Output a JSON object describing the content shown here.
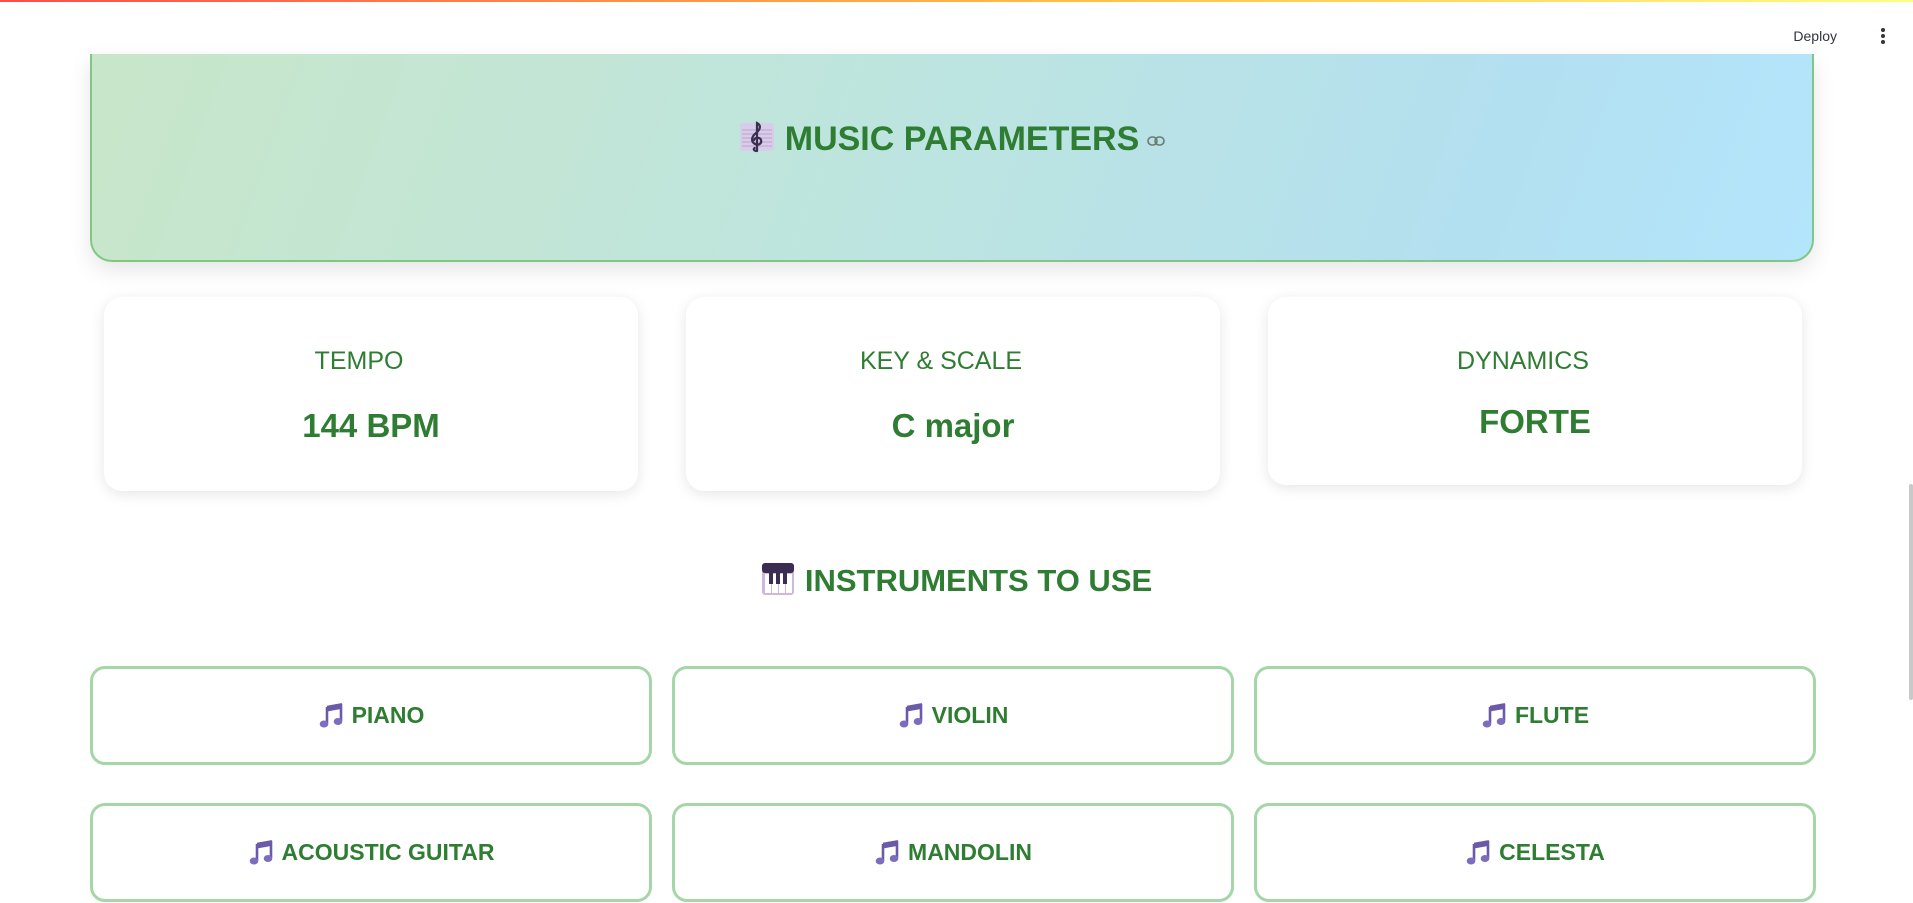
{
  "header": {
    "deploy_label": "Deploy",
    "menu_icon": "kebab-menu-icon"
  },
  "hero": {
    "emoji": "musical-score-icon",
    "title": "MUSIC PARAMETERS",
    "link_icon": "link-icon"
  },
  "params": [
    {
      "label": "TEMPO",
      "value": "144 BPM"
    },
    {
      "label": "KEY & SCALE",
      "value": "C major"
    },
    {
      "label": "DYNAMICS",
      "value": "FORTE"
    }
  ],
  "instruments_section": {
    "emoji": "piano-keyboard-icon",
    "title": "INSTRUMENTS TO USE"
  },
  "instruments": [
    {
      "name": "PIANO",
      "icon": "musical-notes-icon"
    },
    {
      "name": "VIOLIN",
      "icon": "musical-notes-icon"
    },
    {
      "name": "FLUTE",
      "icon": "musical-notes-icon"
    },
    {
      "name": "ACOUSTIC GUITAR",
      "icon": "musical-notes-icon"
    },
    {
      "name": "MANDOLIN",
      "icon": "musical-notes-icon"
    },
    {
      "name": "CELESTA",
      "icon": "musical-notes-icon"
    }
  ],
  "colors": {
    "accent_green": "#2e7d32",
    "border_green": "#a5d6a7",
    "hero_gradient_start": "#c8e6c9",
    "hero_gradient_end": "#b3e5fc",
    "note_purple": "#7b68b5"
  }
}
